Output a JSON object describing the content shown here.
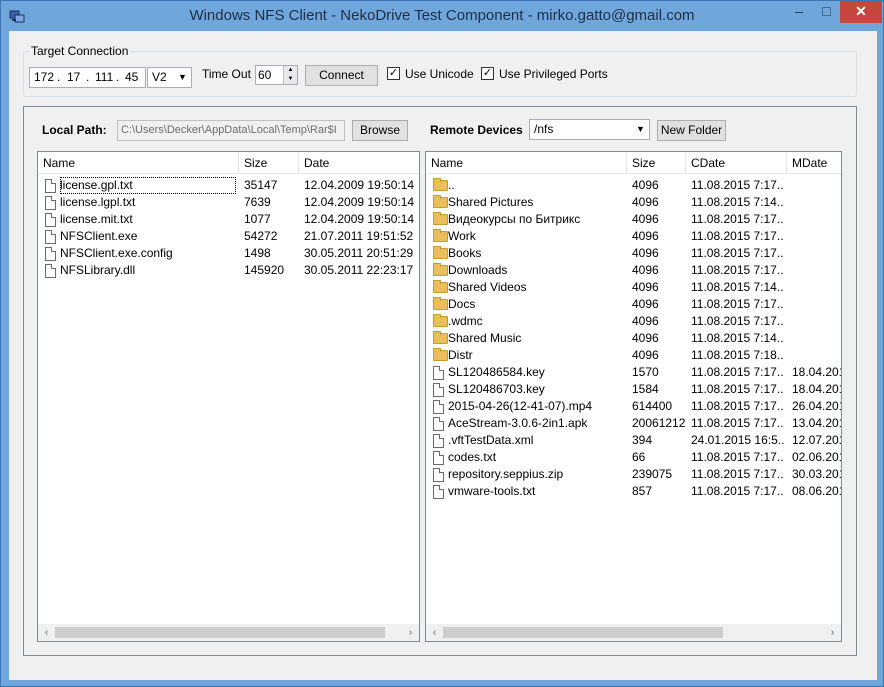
{
  "window": {
    "title": "Windows NFS Client - NekoDrive Test Component - mirko.gatto@gmail.com",
    "minimize": "–",
    "maximize": "□",
    "close": "✕"
  },
  "connection": {
    "group_label": "Target Connection",
    "ip": [
      "172",
      "17",
      "111",
      "45"
    ],
    "version": "V2",
    "timeout_label": "Time Out",
    "timeout_value": "60",
    "connect_label": "Connect",
    "use_unicode_label": "Use Unicode",
    "use_unicode_checked": true,
    "use_privileged_label": "Use Privileged Ports",
    "use_privileged_checked": true
  },
  "local": {
    "path_label": "Local Path:",
    "path_value": "C:\\Users\\Decker\\AppData\\Local\\Temp\\Rar$I",
    "browse_label": "Browse",
    "columns": [
      "Name",
      "Size",
      "Date"
    ],
    "rows": [
      {
        "name": "license.gpl.txt",
        "size": "35147",
        "date": "12.04.2009 19:50:14"
      },
      {
        "name": "license.lgpl.txt",
        "size": "7639",
        "date": "12.04.2009 19:50:14"
      },
      {
        "name": "license.mit.txt",
        "size": "1077",
        "date": "12.04.2009 19:50:14"
      },
      {
        "name": "NFSClient.exe",
        "size": "54272",
        "date": "21.07.2011 19:51:52"
      },
      {
        "name": "NFSClient.exe.config",
        "size": "1498",
        "date": "30.05.2011 20:51:29"
      },
      {
        "name": "NFSLibrary.dll",
        "size": "145920",
        "date": "30.05.2011 22:23:17"
      }
    ]
  },
  "remote": {
    "devices_label": "Remote Devices",
    "device_value": "/nfs",
    "new_folder_label": "New Folder",
    "columns": [
      "Name",
      "Size",
      "CDate",
      "MDate"
    ],
    "rows": [
      {
        "type": "folder",
        "name": "..",
        "size": "4096",
        "cdate": "11.08.2015 7:17...",
        "mdate": ""
      },
      {
        "type": "folder",
        "name": "Shared Pictures",
        "size": "4096",
        "cdate": "11.08.2015 7:14...",
        "mdate": ""
      },
      {
        "type": "folder",
        "name": "Видеокурсы по Битрикс",
        "size": "4096",
        "cdate": "11.08.2015 7:17...",
        "mdate": ""
      },
      {
        "type": "folder",
        "name": "Work",
        "size": "4096",
        "cdate": "11.08.2015 7:17...",
        "mdate": ""
      },
      {
        "type": "folder",
        "name": "Books",
        "size": "4096",
        "cdate": "11.08.2015 7:17...",
        "mdate": ""
      },
      {
        "type": "folder",
        "name": "Downloads",
        "size": "4096",
        "cdate": "11.08.2015 7:17...",
        "mdate": ""
      },
      {
        "type": "folder",
        "name": "Shared Videos",
        "size": "4096",
        "cdate": "11.08.2015 7:14...",
        "mdate": ""
      },
      {
        "type": "folder",
        "name": "Docs",
        "size": "4096",
        "cdate": "11.08.2015 7:17...",
        "mdate": ""
      },
      {
        "type": "folder",
        "name": ".wdmc",
        "size": "4096",
        "cdate": "11.08.2015 7:17...",
        "mdate": ""
      },
      {
        "type": "folder",
        "name": "Shared Music",
        "size": "4096",
        "cdate": "11.08.2015 7:14...",
        "mdate": ""
      },
      {
        "type": "folder",
        "name": "Distr",
        "size": "4096",
        "cdate": "11.08.2015 7:18...",
        "mdate": ""
      },
      {
        "type": "file",
        "name": "SL120486584.key",
        "size": "1570",
        "cdate": "11.08.2015 7:17...",
        "mdate": "18.04.201"
      },
      {
        "type": "file",
        "name": "SL120486703.key",
        "size": "1584",
        "cdate": "11.08.2015 7:17...",
        "mdate": "18.04.201"
      },
      {
        "type": "file",
        "name": "2015-04-26(12-41-07).mp4",
        "size": "614400",
        "cdate": "11.08.2015 7:17...",
        "mdate": "26.04.201"
      },
      {
        "type": "file",
        "name": "AceStream-3.0.6-2in1.apk",
        "size": "20061212",
        "cdate": "11.08.2015 7:17...",
        "mdate": "13.04.201"
      },
      {
        "type": "file",
        "name": ".vftTestData.xml",
        "size": "394",
        "cdate": "24.01.2015 16:5...",
        "mdate": "12.07.201"
      },
      {
        "type": "file",
        "name": "codes.txt",
        "size": "66",
        "cdate": "11.08.2015 7:17...",
        "mdate": "02.06.201"
      },
      {
        "type": "file",
        "name": "repository.seppius.zip",
        "size": "239075",
        "cdate": "11.08.2015 7:17...",
        "mdate": "30.03.201"
      },
      {
        "type": "file",
        "name": "vmware-tools.txt",
        "size": "857",
        "cdate": "11.08.2015 7:17...",
        "mdate": "08.06.201"
      }
    ]
  },
  "scroll_arrows": {
    "left": "‹",
    "right": "›"
  }
}
